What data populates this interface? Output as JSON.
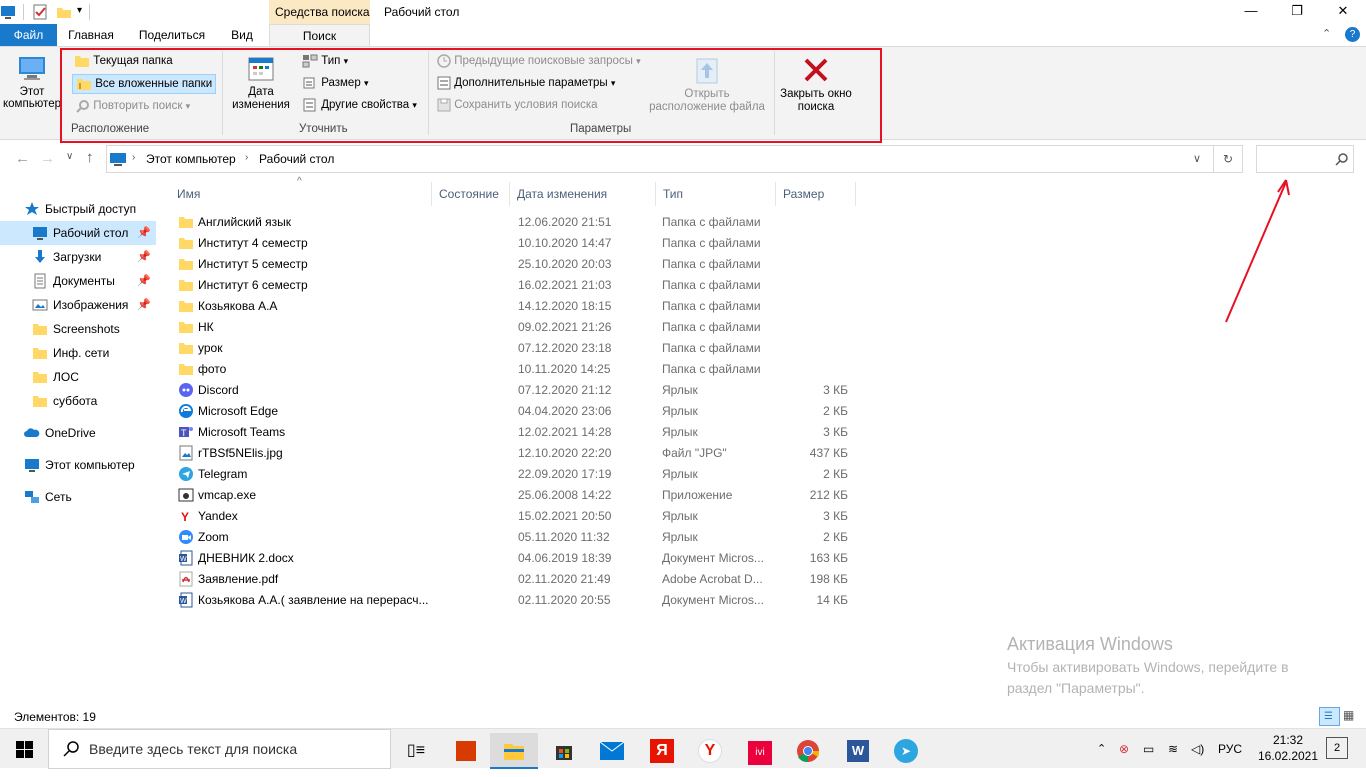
{
  "window": {
    "context_tab": "Средства поиска",
    "title": "Рабочий стол",
    "minimize": "—",
    "restore": "❐",
    "close": "✕"
  },
  "tabs": {
    "file": "Файл",
    "home": "Главная",
    "share": "Поделиться",
    "view": "Вид",
    "search": "Поиск",
    "help_icon": "?"
  },
  "ribbon": {
    "this_pc": "Этот компьютер",
    "current_folder": "Текущая папка",
    "all_subfolders": "Все вложенные папки",
    "repeat_search": "Повторить поиск",
    "location_group": "Расположение",
    "date_modified": "Дата изменения",
    "type": "Тип",
    "size": "Размер",
    "other_props": "Другие свойства",
    "refine_group": "Уточнить",
    "recent_searches": "Предыдущие поисковые запросы",
    "advanced_options": "Дополнительные параметры",
    "save_search": "Сохранить условия поиска",
    "open_location": "Открыть расположение файла",
    "options_group": "Параметры",
    "close_search": "Закрыть окно поиска"
  },
  "address": {
    "root": "Этот компьютер",
    "current": "Рабочий стол"
  },
  "nav": {
    "quick_access": "Быстрый доступ",
    "items": [
      {
        "label": "Рабочий стол",
        "pinned": true
      },
      {
        "label": "Загрузки",
        "pinned": true
      },
      {
        "label": "Документы",
        "pinned": true
      },
      {
        "label": "Изображения",
        "pinned": true
      },
      {
        "label": "Screenshots",
        "pinned": false
      },
      {
        "label": "Инф. сети",
        "pinned": false
      },
      {
        "label": "ЛОС",
        "pinned": false
      },
      {
        "label": "суббота",
        "pinned": false
      }
    ],
    "onedrive": "OneDrive",
    "this_pc": "Этот компьютер",
    "network": "Сеть"
  },
  "columns": {
    "name": "Имя",
    "status": "Состояние",
    "date": "Дата изменения",
    "type": "Тип",
    "size": "Размер"
  },
  "files": [
    {
      "name": "Английский язык",
      "date": "12.06.2020 21:51",
      "type": "Папка с файлами",
      "size": "",
      "icon": "folder"
    },
    {
      "name": "Институт 4 семестр",
      "date": "10.10.2020 14:47",
      "type": "Папка с файлами",
      "size": "",
      "icon": "folder"
    },
    {
      "name": "Институт 5 семестр",
      "date": "25.10.2020 20:03",
      "type": "Папка с файлами",
      "size": "",
      "icon": "folder"
    },
    {
      "name": "Институт 6 семестр",
      "date": "16.02.2021 21:03",
      "type": "Папка с файлами",
      "size": "",
      "icon": "folder"
    },
    {
      "name": "Козьякова А.А",
      "date": "14.12.2020 18:15",
      "type": "Папка с файлами",
      "size": "",
      "icon": "folder"
    },
    {
      "name": "НК",
      "date": "09.02.2021 21:26",
      "type": "Папка с файлами",
      "size": "",
      "icon": "folder"
    },
    {
      "name": "урок",
      "date": "07.12.2020 23:18",
      "type": "Папка с файлами",
      "size": "",
      "icon": "folder"
    },
    {
      "name": "фото",
      "date": "10.11.2020 14:25",
      "type": "Папка с файлами",
      "size": "",
      "icon": "folder"
    },
    {
      "name": "Discord",
      "date": "07.12.2020 21:12",
      "type": "Ярлык",
      "size": "3 КБ",
      "icon": "discord"
    },
    {
      "name": "Microsoft Edge",
      "date": "04.04.2020 23:06",
      "type": "Ярлык",
      "size": "2 КБ",
      "icon": "edge"
    },
    {
      "name": "Microsoft Teams",
      "date": "12.02.2021 14:28",
      "type": "Ярлык",
      "size": "3 КБ",
      "icon": "teams"
    },
    {
      "name": "rTBSf5NElis.jpg",
      "date": "12.10.2020 22:20",
      "type": "Файл \"JPG\"",
      "size": "437 КБ",
      "icon": "image"
    },
    {
      "name": "Telegram",
      "date": "22.09.2020 17:19",
      "type": "Ярлык",
      "size": "2 КБ",
      "icon": "telegram"
    },
    {
      "name": "vmcap.exe",
      "date": "25.06.2008 14:22",
      "type": "Приложение",
      "size": "212 КБ",
      "icon": "exe"
    },
    {
      "name": "Yandex",
      "date": "15.02.2021 20:50",
      "type": "Ярлык",
      "size": "3 КБ",
      "icon": "yandex"
    },
    {
      "name": "Zoom",
      "date": "05.11.2020 11:32",
      "type": "Ярлык",
      "size": "2 КБ",
      "icon": "zoom"
    },
    {
      "name": "ДНЕВНИК 2.docx",
      "date": "04.06.2019 18:39",
      "type": "Документ Micros...",
      "size": "163 КБ",
      "icon": "word"
    },
    {
      "name": "Заявление.pdf",
      "date": "02.11.2020 21:49",
      "type": "Adobe Acrobat D...",
      "size": "198 КБ",
      "icon": "pdf"
    },
    {
      "name": "Козьякова А.А.( заявление на перерасч...",
      "date": "02.11.2020 20:55",
      "type": "Документ Micros...",
      "size": "14 КБ",
      "icon": "word"
    }
  ],
  "status": {
    "items_count": "Элементов: 19"
  },
  "watermark": {
    "title": "Активация Windows",
    "text": "Чтобы активировать Windows, перейдите в раздел \"Параметры\"."
  },
  "taskbar": {
    "search_placeholder": "Введите здесь текст для поиска",
    "lang": "РУС",
    "time": "21:32",
    "date": "16.02.2021",
    "notifications": "2"
  },
  "colors": {
    "accent": "#1979ca",
    "annotation": "#e81123",
    "folder": "#ffd866"
  }
}
